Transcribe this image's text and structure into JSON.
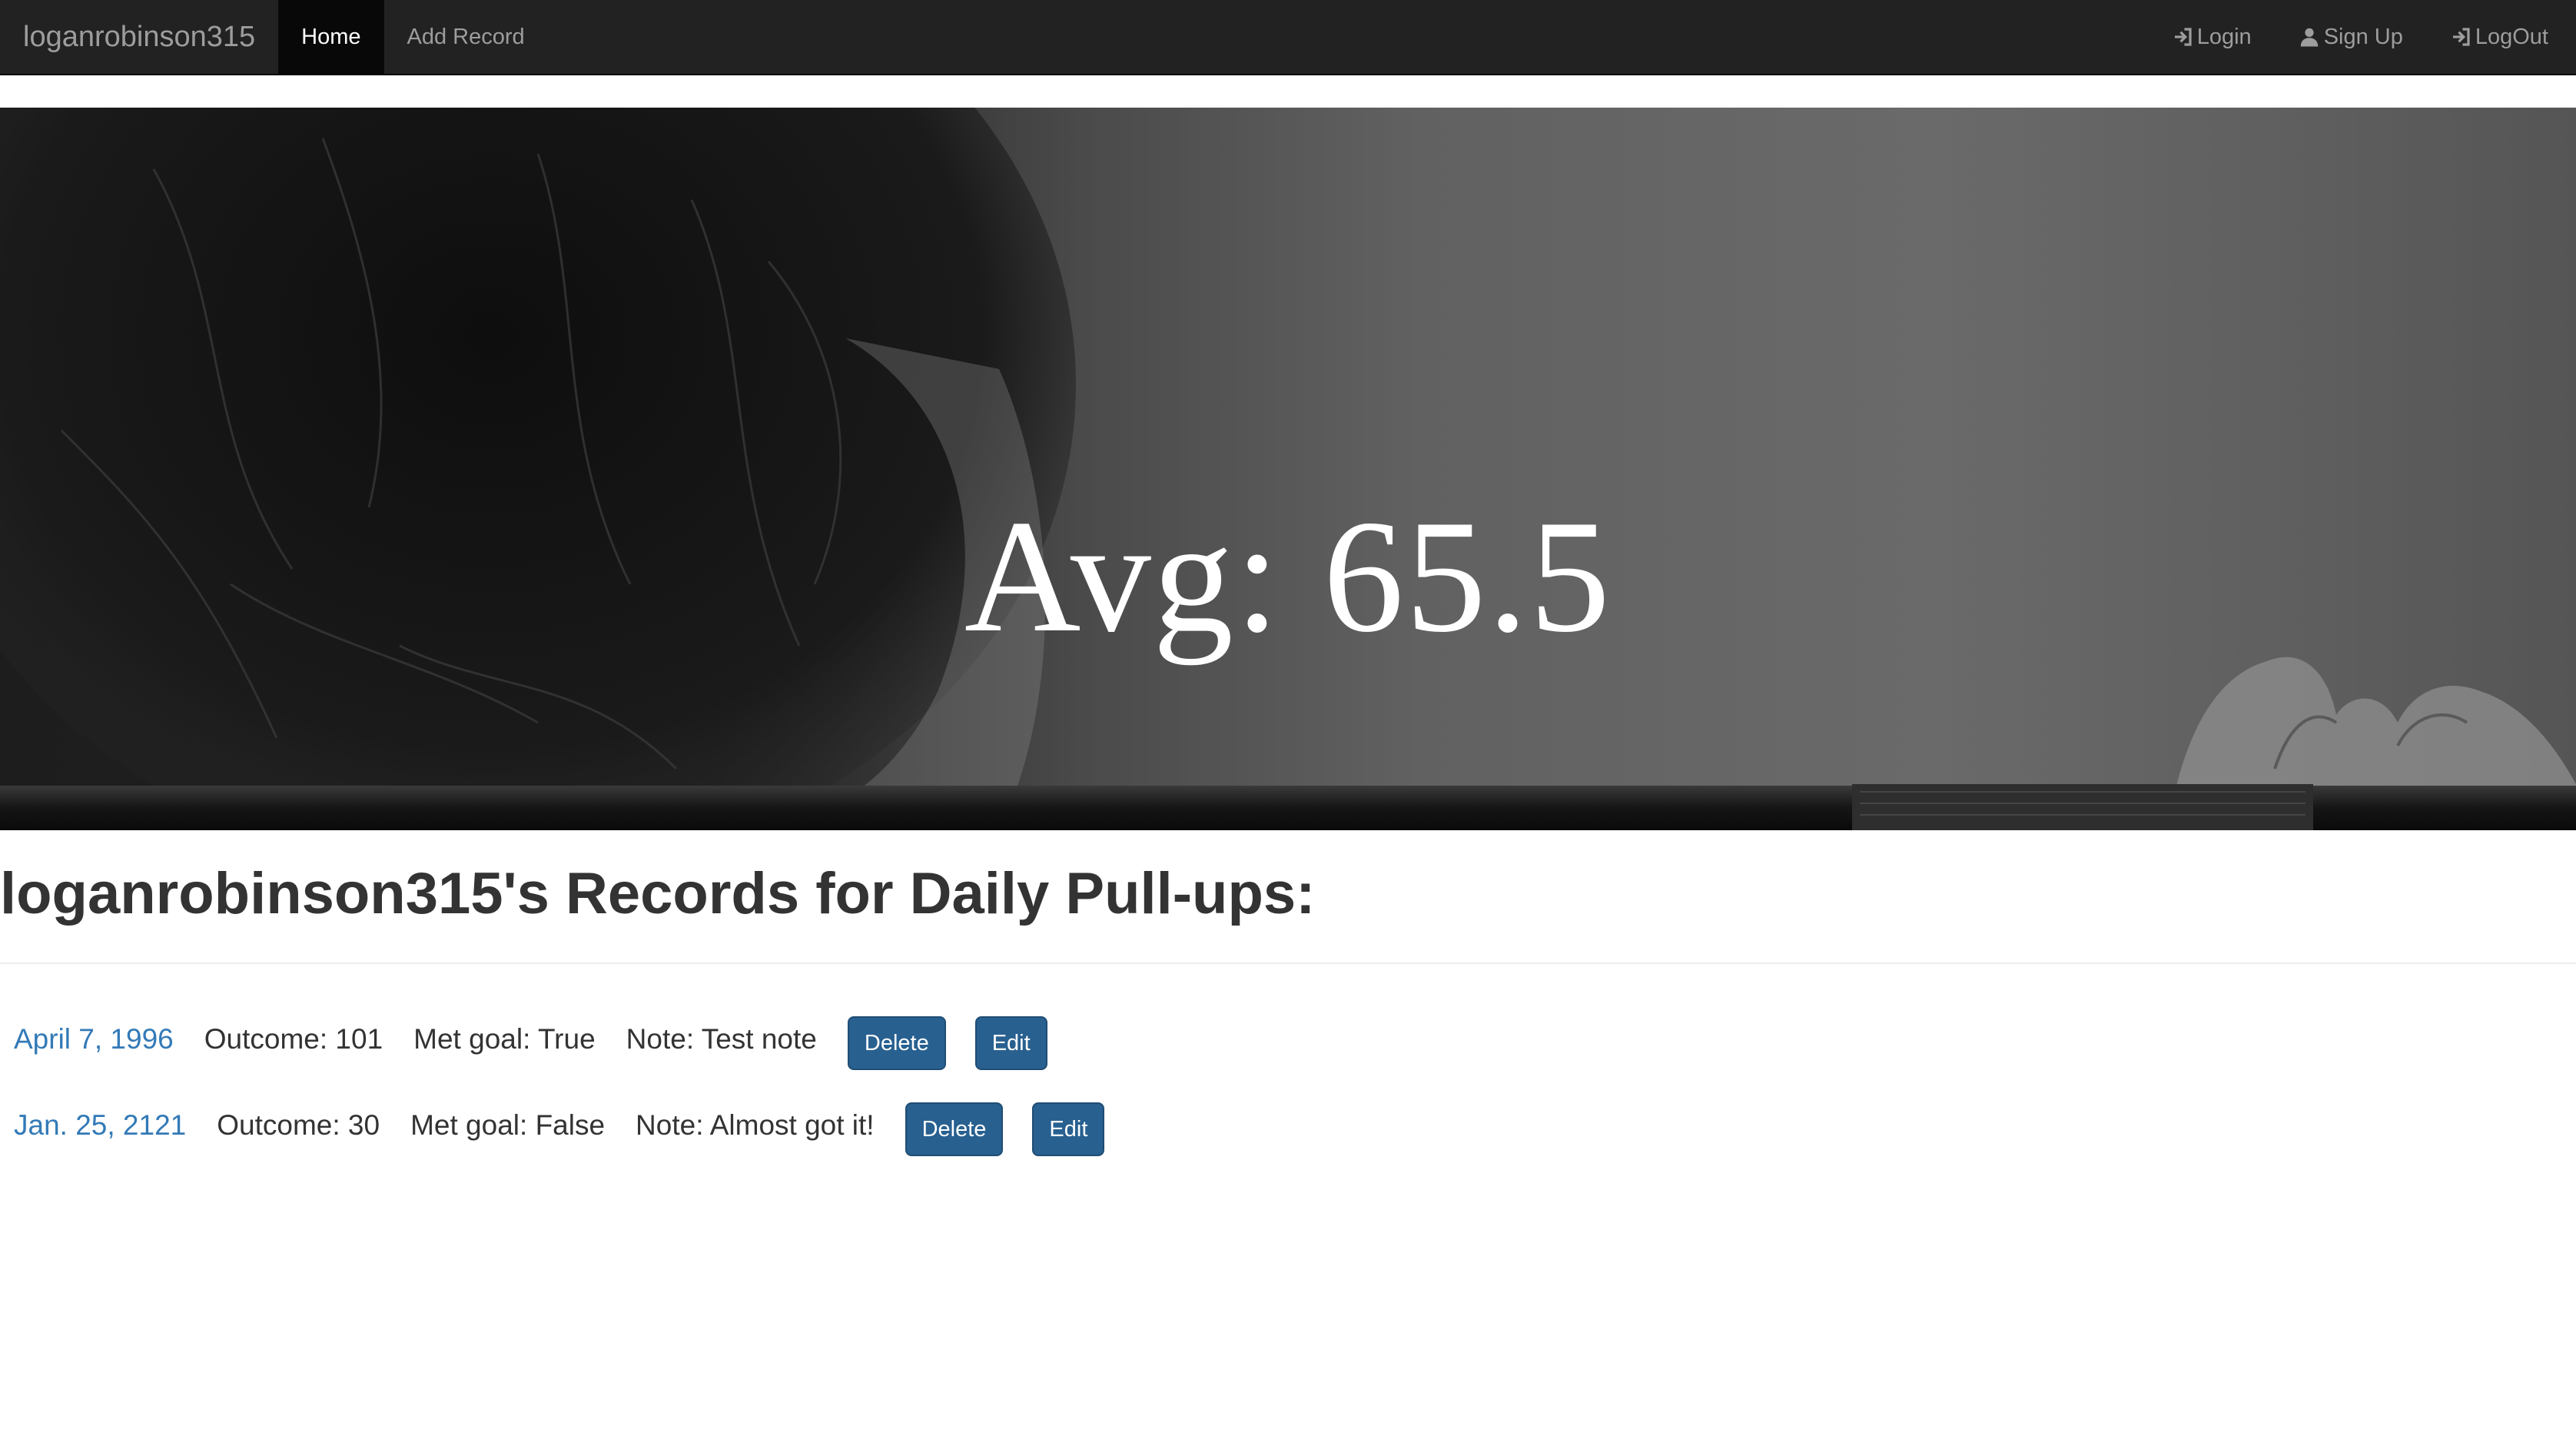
{
  "navbar": {
    "brand": "loganrobinson315",
    "links": [
      {
        "label": "Home",
        "active": true
      },
      {
        "label": "Add Record",
        "active": false
      }
    ],
    "right_links": [
      {
        "label": "Login",
        "icon": "login-icon"
      },
      {
        "label": "Sign Up",
        "icon": "user-icon"
      },
      {
        "label": "LogOut",
        "icon": "login-icon"
      }
    ]
  },
  "hero": {
    "title": "Avg: 65.5"
  },
  "main": {
    "heading": "loganrobinson315's Records for Daily Pull-ups:",
    "records": [
      {
        "date": "April 7, 1996",
        "outcome": "Outcome: 101",
        "met_goal": "Met goal: True",
        "note": "Note: Test note",
        "delete_label": "Delete",
        "edit_label": "Edit"
      },
      {
        "date": "Jan. 25, 2121",
        "outcome": "Outcome: 30",
        "met_goal": "Met goal: False",
        "note": "Note: Almost got it!",
        "delete_label": "Delete",
        "edit_label": "Edit"
      }
    ]
  },
  "colors": {
    "navbar_bg": "#222222",
    "link": "#337ab7",
    "button": "#286090"
  }
}
